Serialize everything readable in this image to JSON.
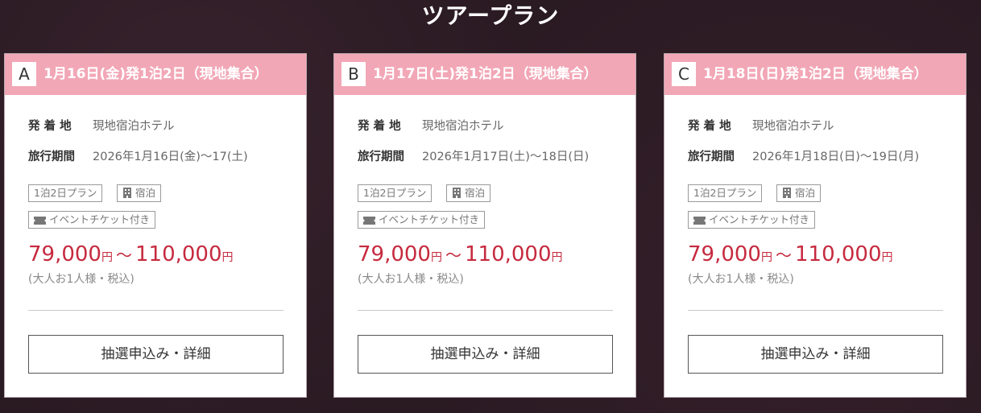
{
  "section": {
    "title": "ツアープラン"
  },
  "labels": {
    "origin": "発 着 地",
    "period": "旅行期間",
    "price_unit": "円",
    "price_sep": "～",
    "price_note": "(大人お1人様・税込)",
    "button": "抽選申込み・詳細"
  },
  "plans": [
    {
      "letter": "A",
      "title": "1月16日(金)発1泊2日（現地集合）",
      "origin": "現地宿泊ホテル",
      "period": "2026年1月16日(金)～17(土)",
      "tags": {
        "nights": "1泊2日プラン",
        "stay": "宿泊",
        "ticket": "イベントチケット付き"
      },
      "price_min": "79,000",
      "price_max": "110,000"
    },
    {
      "letter": "B",
      "title": "1月17日(土)発1泊2日（現地集合）",
      "origin": "現地宿泊ホテル",
      "period": "2026年1月17日(土)～18日(日)",
      "tags": {
        "nights": "1泊2日プラン",
        "stay": "宿泊",
        "ticket": "イベントチケット付き"
      },
      "price_min": "79,000",
      "price_max": "110,000"
    },
    {
      "letter": "C",
      "title": "1月18日(日)発1泊2日（現地集合）",
      "origin": "現地宿泊ホテル",
      "period": "2026年1月18日(日)～19日(月)",
      "tags": {
        "nights": "1泊2日プラン",
        "stay": "宿泊",
        "ticket": "イベントチケット付き"
      },
      "price_min": "79,000",
      "price_max": "110,000"
    }
  ],
  "colors": {
    "header_pink": "#f2a7b6",
    "price_red": "#c62a3f",
    "background": "#2a1a22"
  }
}
